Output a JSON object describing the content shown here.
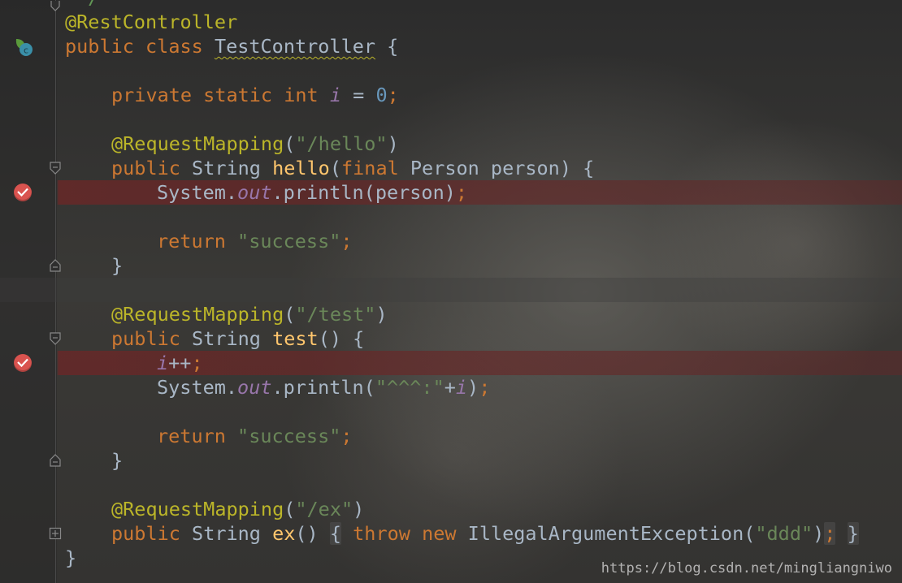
{
  "editor": {
    "theme_colors": {
      "keyword": "#cc7832",
      "annotation": "#bbb529",
      "string": "#6a8759",
      "number": "#6897bb",
      "field": "#9876aa",
      "method": "#ffc66d",
      "text": "#a9b7c6",
      "breakpoint": "#d9534f"
    },
    "gutter_icons": [
      {
        "line": 2,
        "icon": "spring-class-icon"
      },
      {
        "line": 8,
        "icon": "breakpoint-icon"
      },
      {
        "line": 15,
        "icon": "breakpoint-icon"
      }
    ]
  },
  "code": {
    "l0": {
      "comment": "*/"
    },
    "l1": {
      "ann": "@RestController"
    },
    "l2": {
      "kw": "public class",
      "cls": "TestController",
      "rest": " {"
    },
    "l4": {
      "kw": "private static int",
      "fld": "i",
      "eq": " = ",
      "num": "0",
      "semi": ";"
    },
    "l6": {
      "ann": "@RequestMapping",
      "p1": "(",
      "str": "\"/hello\"",
      "p2": ")"
    },
    "l7": {
      "kw": "public",
      "type": "String",
      "mth": "hello",
      "p1": "(",
      "kw2": "final",
      "rest": " Person person) {"
    },
    "l8": {
      "obj": "System.",
      "fld": "out",
      "rest": ".println(person)",
      "semi": ";"
    },
    "l10": {
      "kw": "return",
      "str": "\"success\"",
      "semi": ";"
    },
    "l11": {
      "brace": "}"
    },
    "l13": {
      "ann": "@RequestMapping",
      "p1": "(",
      "str": "\"/test\"",
      "p2": ")"
    },
    "l14": {
      "kw": "public",
      "type": "String",
      "mth": "test",
      "rest": "() {"
    },
    "l15": {
      "fld": "i",
      "rest": "++",
      "semi": ";"
    },
    "l16": {
      "obj": "System.",
      "fld": "out",
      "rest": ".println(",
      "str": "\"^^^:\"",
      "plus": "+",
      "fld2": "i",
      "close": ")",
      "semi": ";"
    },
    "l18": {
      "kw": "return",
      "str": "\"success\"",
      "semi": ";"
    },
    "l19": {
      "brace": "}"
    },
    "l21": {
      "ann": "@RequestMapping",
      "p1": "(",
      "str": "\"/ex\"",
      "p2": ")"
    },
    "l22": {
      "kw": "public",
      "type": "String",
      "mth": "ex",
      "rest": "()",
      "ob": "{",
      "kw2": "throw",
      "kw3": "new",
      "cls": "IllegalArgumentException",
      "p1": "(",
      "str": "\"ddd\"",
      "p2": ")",
      "semi": ";",
      "cb": "}"
    },
    "l23": {
      "brace": "}"
    }
  },
  "watermark": "https://blog.csdn.net/mingliangniwo"
}
